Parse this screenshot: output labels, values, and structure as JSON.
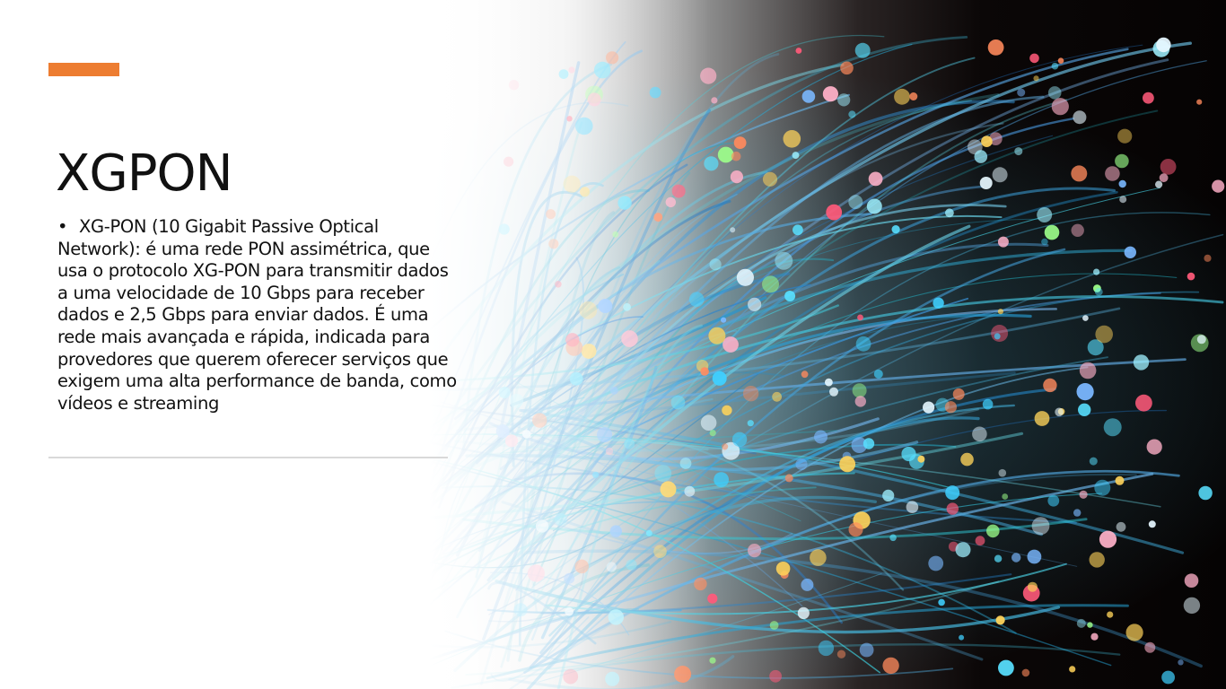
{
  "slide": {
    "title": "XGPON",
    "bullet_symbol": "•",
    "bullets": [
      "XG-PON (10 Gigabit Passive Optical Network): é uma rede PON assimétrica, que usa o protocolo XG-PON para transmitir dados a uma velocidade de 10 Gbps para receber dados e 2,5 Gbps para enviar dados. É uma rede mais avançada e rápida, indicada para provedores que querem oferecer serviços que exigem uma alta performance de banda, como vídeos e streaming"
    ],
    "accent_color": "#ED7D31",
    "divider_color": "#D9D9D9",
    "image_subject": "fiber-optic-cables-image"
  }
}
